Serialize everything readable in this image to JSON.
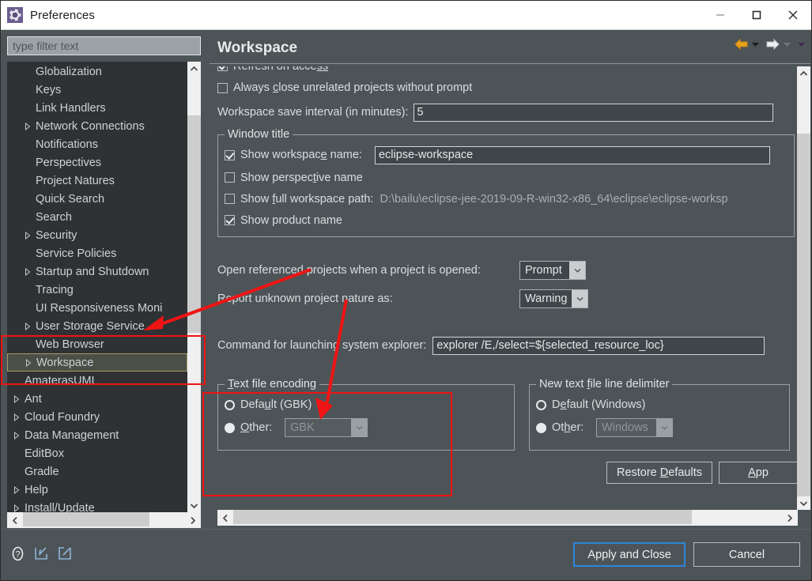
{
  "window": {
    "title": "Preferences",
    "icon": "gear-icon",
    "minimize": "minimize-icon",
    "maximize": "maximize-icon",
    "close": "close-icon"
  },
  "filter": {
    "placeholder": "type filter text",
    "value": ""
  },
  "tree": {
    "items": [
      {
        "label": "Globalization",
        "indent": 1,
        "expandable": false,
        "selected": false
      },
      {
        "label": "Keys",
        "indent": 1,
        "expandable": false,
        "selected": false
      },
      {
        "label": "Link Handlers",
        "indent": 1,
        "expandable": false,
        "selected": false
      },
      {
        "label": "Network Connections",
        "indent": 1,
        "expandable": true,
        "selected": false
      },
      {
        "label": "Notifications",
        "indent": 1,
        "expandable": false,
        "selected": false
      },
      {
        "label": "Perspectives",
        "indent": 1,
        "expandable": false,
        "selected": false
      },
      {
        "label": "Project Natures",
        "indent": 1,
        "expandable": false,
        "selected": false
      },
      {
        "label": "Quick Search",
        "indent": 1,
        "expandable": false,
        "selected": false
      },
      {
        "label": "Search",
        "indent": 1,
        "expandable": false,
        "selected": false
      },
      {
        "label": "Security",
        "indent": 1,
        "expandable": true,
        "selected": false
      },
      {
        "label": "Service Policies",
        "indent": 1,
        "expandable": false,
        "selected": false
      },
      {
        "label": "Startup and Shutdown",
        "indent": 1,
        "expandable": true,
        "selected": false
      },
      {
        "label": "Tracing",
        "indent": 1,
        "expandable": false,
        "selected": false
      },
      {
        "label": "UI Responsiveness Moni",
        "indent": 1,
        "expandable": false,
        "selected": false
      },
      {
        "label": "User Storage Service",
        "indent": 1,
        "expandable": true,
        "selected": false
      },
      {
        "label": "Web Browser",
        "indent": 1,
        "expandable": false,
        "selected": false
      },
      {
        "label": "Workspace",
        "indent": 1,
        "expandable": true,
        "selected": true
      },
      {
        "label": "AmaterasUML",
        "indent": 0,
        "expandable": false,
        "selected": false
      },
      {
        "label": "Ant",
        "indent": 0,
        "expandable": true,
        "selected": false
      },
      {
        "label": "Cloud Foundry",
        "indent": 0,
        "expandable": true,
        "selected": false
      },
      {
        "label": "Data Management",
        "indent": 0,
        "expandable": true,
        "selected": false
      },
      {
        "label": "EditBox",
        "indent": 0,
        "expandable": false,
        "selected": false
      },
      {
        "label": "Gradle",
        "indent": 0,
        "expandable": false,
        "selected": false
      },
      {
        "label": "Help",
        "indent": 0,
        "expandable": true,
        "selected": false
      },
      {
        "label": "Install/Update",
        "indent": 0,
        "expandable": true,
        "selected": false
      }
    ]
  },
  "page": {
    "title": "Workspace",
    "nav": {
      "back": "back-arrow-icon",
      "back_menu": "chevron-down-icon",
      "forward": "forward-arrow-icon",
      "forward_menu": "chevron-down-icon",
      "view_menu": "chevron-down-icon"
    },
    "refresh_on_access": {
      "label": "Refresh on access",
      "checked": true
    },
    "always_close_unrelated": {
      "label": "Always close unrelated projects without prompt",
      "checked": false
    },
    "save_interval": {
      "label": "Workspace save interval (in minutes):",
      "value": "5"
    },
    "window_title_group": {
      "legend": "Window title",
      "show_workspace_name": {
        "label": "Show workspace name:",
        "checked": true,
        "value": "eclipse-workspace"
      },
      "show_perspective_name": {
        "label": "Show perspective name",
        "checked": false
      },
      "show_full_workspace_path": {
        "label": "Show full workspace path:",
        "checked": false,
        "value": "D:\\bailu\\eclipse-jee-2019-09-R-win32-x86_64\\eclipse\\eclipse-worksp"
      },
      "show_product_name": {
        "label": "Show product name",
        "checked": true
      }
    },
    "open_referenced": {
      "label": "Open referenced projects when a project is opened:",
      "value": "Prompt"
    },
    "report_unknown_nature": {
      "label": "Report unknown project nature as:",
      "value": "Warning"
    },
    "system_explorer": {
      "label": "Command for launching system explorer:",
      "value": "explorer /E,/select=${selected_resource_loc}"
    },
    "text_file_encoding": {
      "legend": "Text file encoding",
      "default_label": "Default (GBK)",
      "default_selected": true,
      "other_label": "Other:",
      "other_selected": false,
      "other_value": "GBK"
    },
    "line_delimiter": {
      "legend": "New text file line delimiter",
      "default_label": "Default (Windows)",
      "default_selected": true,
      "other_label": "Other:",
      "other_selected": false,
      "other_value": "Windows"
    },
    "restore_defaults": "Restore Defaults",
    "apply": "App"
  },
  "bottom": {
    "help_icon": "help-icon",
    "import_icon": "import-icon",
    "export_icon": "export-icon",
    "apply_and_close": "Apply and Close",
    "cancel": "Cancel"
  },
  "annotations": {
    "color": "#f01414",
    "rect_tree_label": "red-highlight-rect-tree",
    "rect_encoding_label": "red-highlight-rect-encoding",
    "arrow_to_workspace": "red-arrow-to-workspace",
    "arrow_to_encoding": "red-arrow-to-text-file-encoding"
  }
}
